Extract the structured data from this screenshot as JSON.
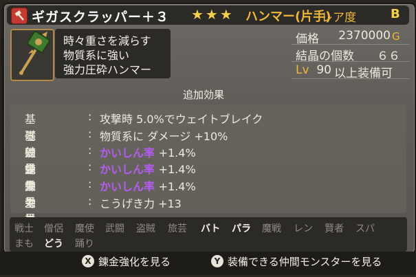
{
  "item": {
    "name": "ギガスクラッパー＋３",
    "stars": "★★★",
    "type": "ハンマー(片手)",
    "rarity_label": "レア度",
    "rarity": "B",
    "description": [
      "時々重さを減らす",
      "物質系に強い",
      "強力圧砕ハンマー"
    ]
  },
  "stats": {
    "price_label": "価格",
    "price": "2370000",
    "price_unit": "G",
    "crystal_label": "結晶の個数",
    "crystal_count": "６６",
    "level_label": "Lv",
    "level": "90",
    "level_suffix": "以上装備可"
  },
  "extra_effects": {
    "title": "追加効果",
    "rows": [
      {
        "category": "基礎効果",
        "value": "攻撃時 5.0%でウェイトブレイク"
      },
      {
        "category": "基礎効果",
        "value": "物質系に ダメージ +10%"
      },
      {
        "category": "錬金効果",
        "value": "かいしん率",
        "bonus": "+1.4%"
      },
      {
        "category": "錬金効果",
        "value": "かいしん率",
        "bonus": "+1.4%"
      },
      {
        "category": "錬金効果",
        "value": "かいしん率",
        "bonus": "+1.4%"
      },
      {
        "category": "できのよさ",
        "value": "こうげき力 +13"
      }
    ]
  },
  "jobs": [
    {
      "label": "戦士",
      "equippable": false
    },
    {
      "label": "僧侶",
      "equippable": false
    },
    {
      "label": "魔使",
      "equippable": false
    },
    {
      "label": "武闘",
      "equippable": false
    },
    {
      "label": "盗賊",
      "equippable": false
    },
    {
      "label": "旅芸",
      "equippable": false
    },
    {
      "label": "バト",
      "equippable": true
    },
    {
      "label": "パラ",
      "equippable": true
    },
    {
      "label": "魔戦",
      "equippable": false
    },
    {
      "label": "レン",
      "equippable": false
    },
    {
      "label": "賢者",
      "equippable": false
    },
    {
      "label": "スパ",
      "equippable": false
    },
    {
      "label": "まも",
      "equippable": false
    },
    {
      "label": "どう",
      "equippable": true
    },
    {
      "label": "踊り",
      "equippable": false
    }
  ],
  "footer": {
    "x_button": "X",
    "x_label": "錬金強化を見る",
    "y_button": "Y",
    "y_label": "装備できる仲間モンスターを見る"
  },
  "colors": {
    "gold": "#f0b83a",
    "alchemy_purple": "#b35cf2",
    "title_icon_red": "#c23b32"
  }
}
